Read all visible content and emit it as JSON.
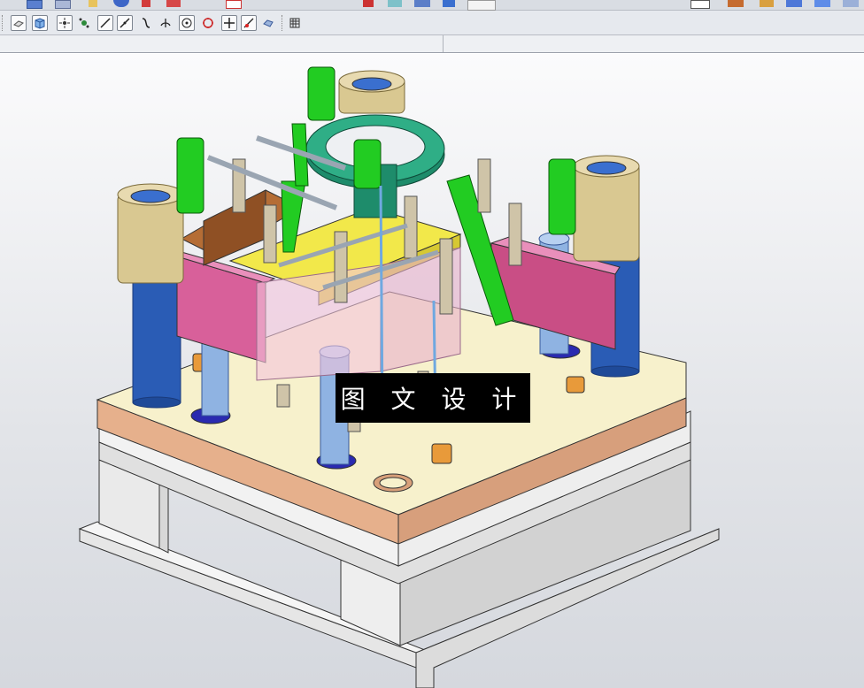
{
  "window": {
    "type": "cad-3d-viewport"
  },
  "toolbar_top": {
    "icons": [
      "save-icon",
      "print-icon",
      "copy-icon",
      "undo-icon",
      "link-icon",
      "palette-icon",
      "box-icon",
      "layer-icon",
      "dropdown-icon"
    ]
  },
  "toolbar_snap": {
    "icons": [
      "view-orient-icon",
      "shaded-cube-icon",
      "snap-point-icon",
      "snap-endpoint-icon",
      "snap-line-icon",
      "snap-diagonal-icon",
      "snap-curve-icon",
      "snap-perpendicular-icon",
      "snap-center-icon",
      "snap-quadrant-icon",
      "snap-intersection-icon",
      "snap-tangent-icon",
      "snap-arc-icon",
      "grid-icon"
    ]
  },
  "viewport": {
    "model": "injection-mold-assembly",
    "background_top": "#fbfbfc",
    "background_bottom": "#d5d8de"
  },
  "watermark": {
    "text": "图 文 设 计"
  },
  "colors": {
    "plate_top": "#f7f1cc",
    "plate_edge": "#d4a07f",
    "base_plate": "#f0f0f0",
    "guide_pillar": "#2a5cb5",
    "bushing": "#d9c891",
    "green_part": "#22cc22",
    "ring": "#1e8c6b",
    "slider": "#d45a8a",
    "cavity": "#f2e84a",
    "brown_block": "#9a5a2e"
  }
}
